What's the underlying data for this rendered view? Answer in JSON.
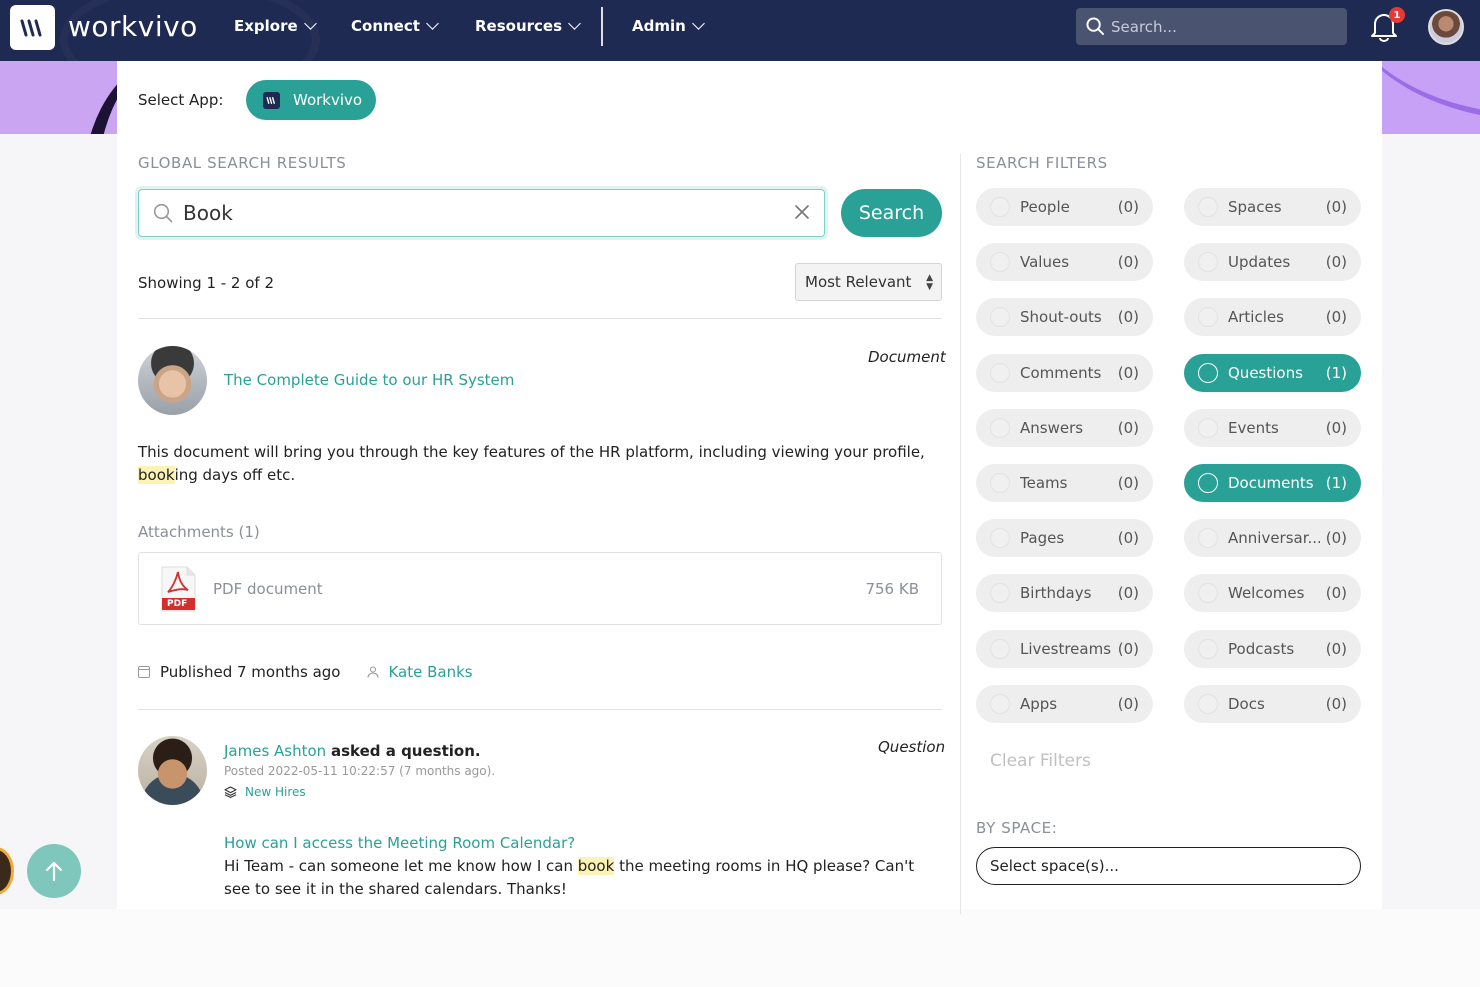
{
  "topnav": {
    "brand": "workvivo",
    "items": [
      {
        "label": "Explore"
      },
      {
        "label": "Connect"
      },
      {
        "label": "Resources"
      },
      {
        "label": "Admin"
      }
    ],
    "search_placeholder": "Search...",
    "notification_count": "1"
  },
  "app_select": {
    "label": "Select App:",
    "selected": "Workvivo"
  },
  "results": {
    "heading": "GLOBAL SEARCH RESULTS",
    "query": "Book",
    "search_button": "Search",
    "showing": "Showing 1 - 2 of 2",
    "sort": "Most Relevant",
    "items": [
      {
        "type": "Document",
        "title": "The Complete Guide to our HR System",
        "body_before": "This document will bring you through the key features of the HR platform, including viewing your profile, ",
        "body_highlight": "book",
        "body_after": "ing days off etc.",
        "attachments_label": "Attachments (1)",
        "attachment_name": "PDF document",
        "attachment_size": "756 KB",
        "attachment_badge": "PDF",
        "published": "Published 7 months ago",
        "author": "Kate Banks"
      },
      {
        "type": "Question",
        "author": "James Ashton",
        "action": "asked a question.",
        "posted": "Posted 2022-05-11 10:22:57 (7 months ago).",
        "space": "New Hires",
        "question_title": "How can I access the Meeting Room Calendar?",
        "body_before": "Hi Team - can someone let me know how I can ",
        "body_highlight": "book",
        "body_after": " the meeting rooms in HQ please? Can't see to see it in the shared calendars. Thanks!"
      }
    ]
  },
  "filters": {
    "heading": "SEARCH FILTERS",
    "items": [
      {
        "name": "People",
        "count": "(0)",
        "active": false
      },
      {
        "name": "Spaces",
        "count": "(0)",
        "active": false
      },
      {
        "name": "Values",
        "count": "(0)",
        "active": false
      },
      {
        "name": "Updates",
        "count": "(0)",
        "active": false
      },
      {
        "name": "Shout-outs",
        "count": "(0)",
        "active": false
      },
      {
        "name": "Articles",
        "count": "(0)",
        "active": false
      },
      {
        "name": "Comments",
        "count": "(0)",
        "active": false
      },
      {
        "name": "Questions",
        "count": "(1)",
        "active": true
      },
      {
        "name": "Answers",
        "count": "(0)",
        "active": false
      },
      {
        "name": "Events",
        "count": "(0)",
        "active": false
      },
      {
        "name": "Teams",
        "count": "(0)",
        "active": false
      },
      {
        "name": "Documents",
        "count": "(1)",
        "active": true
      },
      {
        "name": "Pages",
        "count": "(0)",
        "active": false
      },
      {
        "name": "Anniversar...",
        "count": "(0)",
        "active": false
      },
      {
        "name": "Birthdays",
        "count": "(0)",
        "active": false
      },
      {
        "name": "Welcomes",
        "count": "(0)",
        "active": false
      },
      {
        "name": "Livestreams",
        "count": "(0)",
        "active": false
      },
      {
        "name": "Podcasts",
        "count": "(0)",
        "active": false
      },
      {
        "name": "Apps",
        "count": "(0)",
        "active": false
      },
      {
        "name": "Docs",
        "count": "(0)",
        "active": false
      }
    ],
    "clear_label": "Clear Filters",
    "by_space_heading": "BY SPACE:",
    "space_placeholder": "Select space(s)..."
  },
  "colors": {
    "accent": "#2aa197",
    "nav_bg": "#1f2a52",
    "banner": "#c9a5f2",
    "highlight": "#fbf2b4"
  }
}
